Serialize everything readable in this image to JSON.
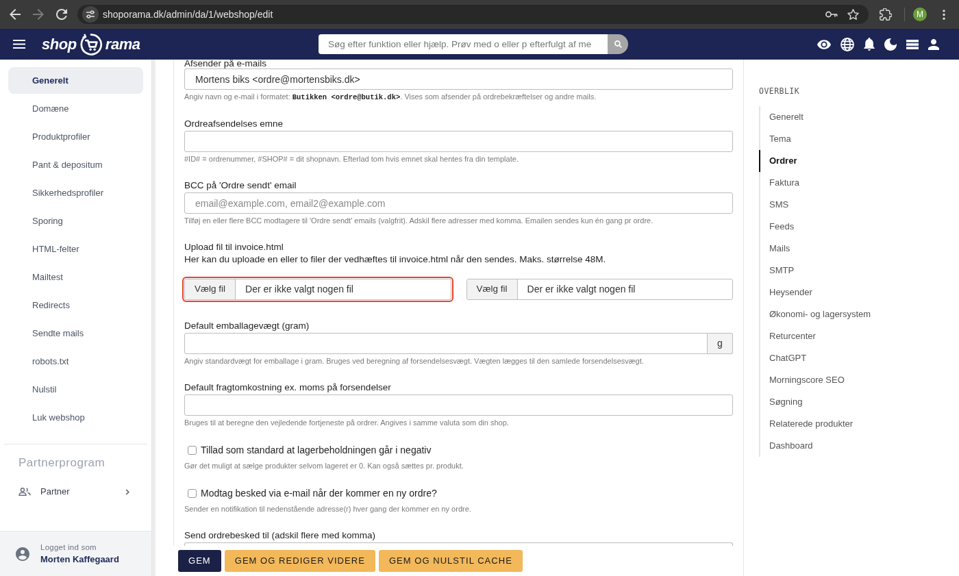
{
  "browser": {
    "url": "shoporama.dk/admin/da/1/webshop/edit",
    "forward_disabled": true,
    "profile_initial": "M"
  },
  "header": {
    "logo": {
      "left": "shop",
      "right": "rama"
    },
    "search": {
      "placeholder": "Søg efter funktion eller hjælp. Prøv med o eller p efterfulgt af me"
    }
  },
  "sidebar": {
    "items": [
      {
        "label": "Generelt",
        "selected": true
      },
      {
        "label": "Domæne",
        "selected": false
      },
      {
        "label": "Produktprofiler",
        "selected": false
      },
      {
        "label": "Pant & depositum",
        "selected": false
      },
      {
        "label": "Sikkerhedsprofiler",
        "selected": false
      },
      {
        "label": "Sporing",
        "selected": false
      },
      {
        "label": "HTML-felter",
        "selected": false
      },
      {
        "label": "Mailtest",
        "selected": false
      },
      {
        "label": "Redirects",
        "selected": false
      },
      {
        "label": "Sendte mails",
        "selected": false
      },
      {
        "label": "robots.txt",
        "selected": false
      },
      {
        "label": "Nulstil",
        "selected": false
      },
      {
        "label": "Luk webshop",
        "selected": false
      }
    ],
    "section_title": "Partnerprogram",
    "section_items": [
      {
        "label": "Partner"
      }
    ],
    "user": {
      "caption": "Logget ind som",
      "name": "Morten Kaffegaard"
    }
  },
  "form": {
    "fields": [
      {
        "kind": "text",
        "label": "Afsender på e-mails",
        "value": "Mortens biks <ordre@mortensbiks.dk>",
        "help": "Angiv navn og e-mail i formatet: **Butikken <ordre@butik.dk>**. Vises som afsender på ordrebekræftelser og andre mails."
      },
      {
        "kind": "text",
        "label": "Ordreafsendelses emne",
        "help": "#ID# = ordrenummer, #SHOP# = dit shopnavn. Efterlad tom hvis emnet skal hentes fra din template."
      },
      {
        "kind": "text",
        "label": "BCC på 'Ordre sendt' email",
        "placeholder": "email@example.com, email2@example.com",
        "help": "Tilføj en eller flere BCC modtagere til 'Ordre sendt' emails (valgfrit). Adskil flere adresser med komma. Emailen sendes kun én gang pr ordre."
      },
      {
        "kind": "upload",
        "label": "Upload fil til invoice.html",
        "description": "Her kan du uploade en eller to filer der vedhæftes til invoice.html når den sendes. Maks. størrelse 48M.",
        "files": [
          {
            "button": "Vælg fil",
            "status": "Der er ikke valgt nogen fil",
            "focused": true
          },
          {
            "button": "Vælg fil",
            "status": "Der er ikke valgt nogen fil",
            "focused": false
          }
        ]
      },
      {
        "kind": "addon",
        "label": "Default emballagevægt (gram)",
        "unit": "g",
        "help": "Angiv standardvægt for emballage i gram. Bruges ved beregning af forsendelsesvægt. Vægten lægges til den samlede forsendelsesvægt."
      },
      {
        "kind": "text",
        "label": "Default fragtomkostning ex. moms på forsendelser",
        "help": "Bruges til at beregne den vejledende fortjeneste på ordrer. Angives i samme valuta som din shop."
      },
      {
        "kind": "checkbox",
        "label": "Tillad som standard at lagerbeholdningen går i negativ",
        "checked": false,
        "help": "Gør det muligt at sælge produkter selvom lageret er 0. Kan også sættes pr. produkt."
      },
      {
        "kind": "checkbox",
        "label": "Modtag besked via e-mail når der kommer en ny ordre?",
        "checked": false,
        "help": "Sender en notifikation til nedenstående adresse(r) hver gang der kommer en ny ordre."
      },
      {
        "kind": "text",
        "label": "Send ordrebesked til (adskil flere med komma)"
      }
    ]
  },
  "actions": [
    {
      "label": "GEM",
      "kind": "primary"
    },
    {
      "label": "GEM OG REDIGER VIDERE",
      "kind": "secondary"
    },
    {
      "label": "GEM OG NULSTIL CACHE",
      "kind": "secondary"
    }
  ],
  "overview": {
    "title": "OVERBLIK",
    "items": [
      {
        "label": "Generelt",
        "selected": false
      },
      {
        "label": "Tema",
        "selected": false
      },
      {
        "label": "Ordrer",
        "selected": true
      },
      {
        "label": "Faktura",
        "selected": false
      },
      {
        "label": "SMS",
        "selected": false
      },
      {
        "label": "Feeds",
        "selected": false
      },
      {
        "label": "Mails",
        "selected": false
      },
      {
        "label": "SMTP",
        "selected": false
      },
      {
        "label": "Heysender",
        "selected": false
      },
      {
        "label": "Økonomi- og lagersystem",
        "selected": false
      },
      {
        "label": "Returcenter",
        "selected": false
      },
      {
        "label": "ChatGPT",
        "selected": false
      },
      {
        "label": "Morningscore SEO",
        "selected": false
      },
      {
        "label": "Søgning",
        "selected": false
      },
      {
        "label": "Relaterede produkter",
        "selected": false
      },
      {
        "label": "Dashboard",
        "selected": false
      }
    ]
  }
}
